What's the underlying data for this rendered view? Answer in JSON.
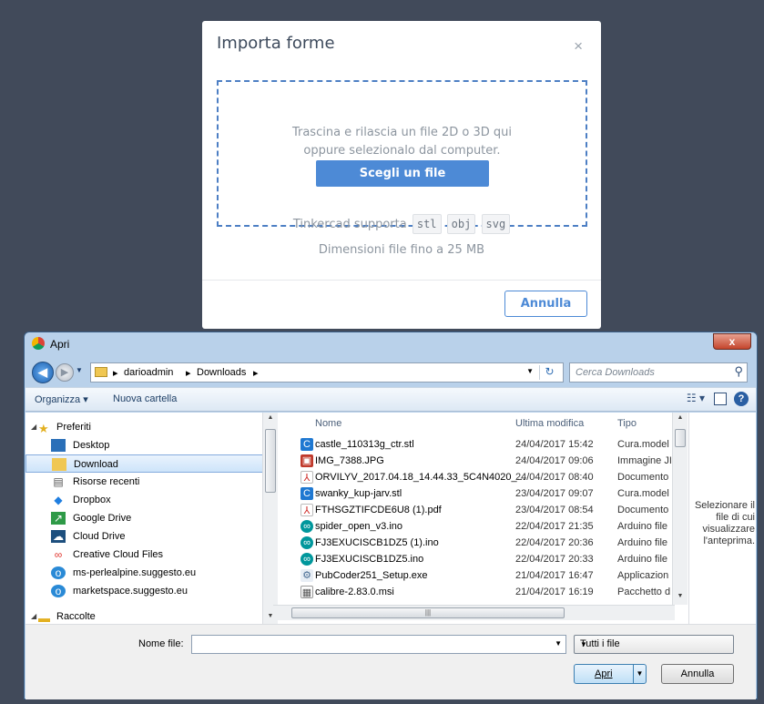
{
  "modal": {
    "title": "Importa forme",
    "close": "×",
    "drop_line1": "Trascina e rilascia un file 2D o 3D qui",
    "drop_line2": "oppure selezionalo dal computer.",
    "choose_button": "Scegli un file",
    "support_text": "Tinkercad supporta",
    "formats": [
      "stl",
      "obj",
      "svg"
    ],
    "limit_text": "Dimensioni file fino a 25 MB",
    "cancel_button": "Annulla",
    "colors": {
      "accent": "#4d8ad6",
      "dashed_border": "#4d7fc4"
    }
  },
  "dialog": {
    "title": "Apri",
    "close_glyph": "x",
    "breadcrumb": [
      "darioadmin",
      "Downloads"
    ],
    "search_placeholder": "Cerca Downloads",
    "toolbar": {
      "organize": "Organizza ▾",
      "new_folder": "Nuova cartella"
    },
    "tree": {
      "favorites_label": "Preferiti",
      "items": [
        {
          "label": "Desktop",
          "icon": "desktop-icon"
        },
        {
          "label": "Download",
          "icon": "download-folder-icon",
          "selected": true
        },
        {
          "label": "Risorse recenti",
          "icon": "recent-icon"
        },
        {
          "label": "Dropbox",
          "icon": "dropbox-icon"
        },
        {
          "label": "Google Drive",
          "icon": "google-drive-icon"
        },
        {
          "label": "Cloud Drive",
          "icon": "cloud-drive-icon"
        },
        {
          "label": "Creative Cloud Files",
          "icon": "creative-cloud-icon"
        },
        {
          "label": "ms-perlealpine.suggesto.eu",
          "icon": "web-icon"
        },
        {
          "label": "marketspace.suggesto.eu",
          "icon": "web-icon"
        }
      ],
      "collections_label": "Raccolte"
    },
    "columns": {
      "name": "Nome",
      "modified": "Ultima modifica",
      "type": "Tipo"
    },
    "files": [
      {
        "name": "castle_110313g_ctr.stl",
        "modified": "24/04/2017 15:42",
        "type": "Cura.model",
        "icon": "cura-icon"
      },
      {
        "name": "IMG_7388.JPG",
        "modified": "24/04/2017 09:06",
        "type": "Immagine JI",
        "icon": "image-icon"
      },
      {
        "name": "ORVILYV_2017.04.18_14.44.33_5C4N4020_...",
        "modified": "24/04/2017 08:40",
        "type": "Documento",
        "icon": "pdf-icon"
      },
      {
        "name": "swanky_kup-jarv.stl",
        "modified": "23/04/2017 09:07",
        "type": "Cura.model",
        "icon": "cura-icon"
      },
      {
        "name": "FTHSGZTIFCDE6U8 (1).pdf",
        "modified": "23/04/2017 08:54",
        "type": "Documento",
        "icon": "pdf-icon"
      },
      {
        "name": "spider_open_v3.ino",
        "modified": "22/04/2017 21:35",
        "type": "Arduino file",
        "icon": "arduino-icon"
      },
      {
        "name": "FJ3EXUCISCB1DZ5 (1).ino",
        "modified": "22/04/2017 20:36",
        "type": "Arduino file",
        "icon": "arduino-icon"
      },
      {
        "name": "FJ3EXUCISCB1DZ5.ino",
        "modified": "22/04/2017 20:33",
        "type": "Arduino file",
        "icon": "arduino-icon"
      },
      {
        "name": "PubCoder251_Setup.exe",
        "modified": "21/04/2017 16:47",
        "type": "Applicazion",
        "icon": "exe-icon"
      },
      {
        "name": "calibre-2.83.0.msi",
        "modified": "21/04/2017 16:19",
        "type": "Pacchetto d",
        "icon": "msi-icon"
      }
    ],
    "preview_text": "Selezionare il file di cui visualizzare l'anteprima.",
    "filename_label": "Nome file:",
    "filename_value": "",
    "filetype_value": "Tutti i file",
    "open_button": "Apri",
    "cancel_button": "Annulla"
  }
}
